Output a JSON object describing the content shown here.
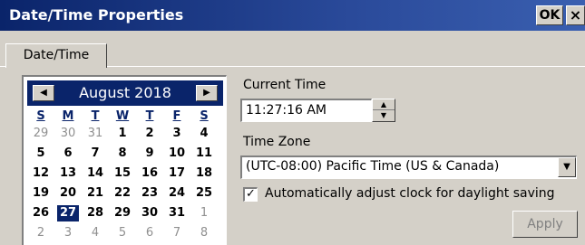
{
  "window": {
    "title": "Date/Time Properties",
    "ok_label": "OK",
    "close_label": "×"
  },
  "tabs": [
    {
      "label": "Date/Time",
      "active": true
    }
  ],
  "calendar": {
    "month_title": "August 2018",
    "prev_icon": "◀",
    "next_icon": "▶",
    "weekdays": [
      "S",
      "M",
      "T",
      "W",
      "T",
      "F",
      "S"
    ],
    "weeks": [
      [
        {
          "d": "29",
          "other": true
        },
        {
          "d": "30",
          "other": true
        },
        {
          "d": "31",
          "other": true
        },
        {
          "d": "1"
        },
        {
          "d": "2"
        },
        {
          "d": "3"
        },
        {
          "d": "4"
        }
      ],
      [
        {
          "d": "5"
        },
        {
          "d": "6"
        },
        {
          "d": "7"
        },
        {
          "d": "8"
        },
        {
          "d": "9"
        },
        {
          "d": "10"
        },
        {
          "d": "11"
        }
      ],
      [
        {
          "d": "12"
        },
        {
          "d": "13"
        },
        {
          "d": "14"
        },
        {
          "d": "15"
        },
        {
          "d": "16"
        },
        {
          "d": "17"
        },
        {
          "d": "18"
        }
      ],
      [
        {
          "d": "19"
        },
        {
          "d": "20"
        },
        {
          "d": "21"
        },
        {
          "d": "22"
        },
        {
          "d": "23"
        },
        {
          "d": "24"
        },
        {
          "d": "25"
        }
      ],
      [
        {
          "d": "26"
        },
        {
          "d": "27",
          "selected": true
        },
        {
          "d": "28"
        },
        {
          "d": "29"
        },
        {
          "d": "30"
        },
        {
          "d": "31"
        },
        {
          "d": "1",
          "other": true
        }
      ],
      [
        {
          "d": "2",
          "other": true
        },
        {
          "d": "3",
          "other": true
        },
        {
          "d": "4",
          "other": true
        },
        {
          "d": "5",
          "other": true
        },
        {
          "d": "6",
          "other": true
        },
        {
          "d": "7",
          "other": true
        },
        {
          "d": "8",
          "other": true
        }
      ]
    ]
  },
  "current_time": {
    "label": "Current Time",
    "value": "11:27:16 AM",
    "up_icon": "▲",
    "down_icon": "▼"
  },
  "time_zone": {
    "label": "Time Zone",
    "value": "(UTC-08:00) Pacific Time (US & Canada)",
    "dropdown_icon": "▼"
  },
  "daylight": {
    "label": "Automatically adjust clock for daylight saving",
    "checked": true,
    "check_glyph": "✓"
  },
  "apply_label": "Apply",
  "colors": {
    "title_bar": "#0a246a",
    "dialog_bg": "#d4d0c8",
    "selected_day": "#0a246a",
    "disabled_text": "#808080"
  }
}
